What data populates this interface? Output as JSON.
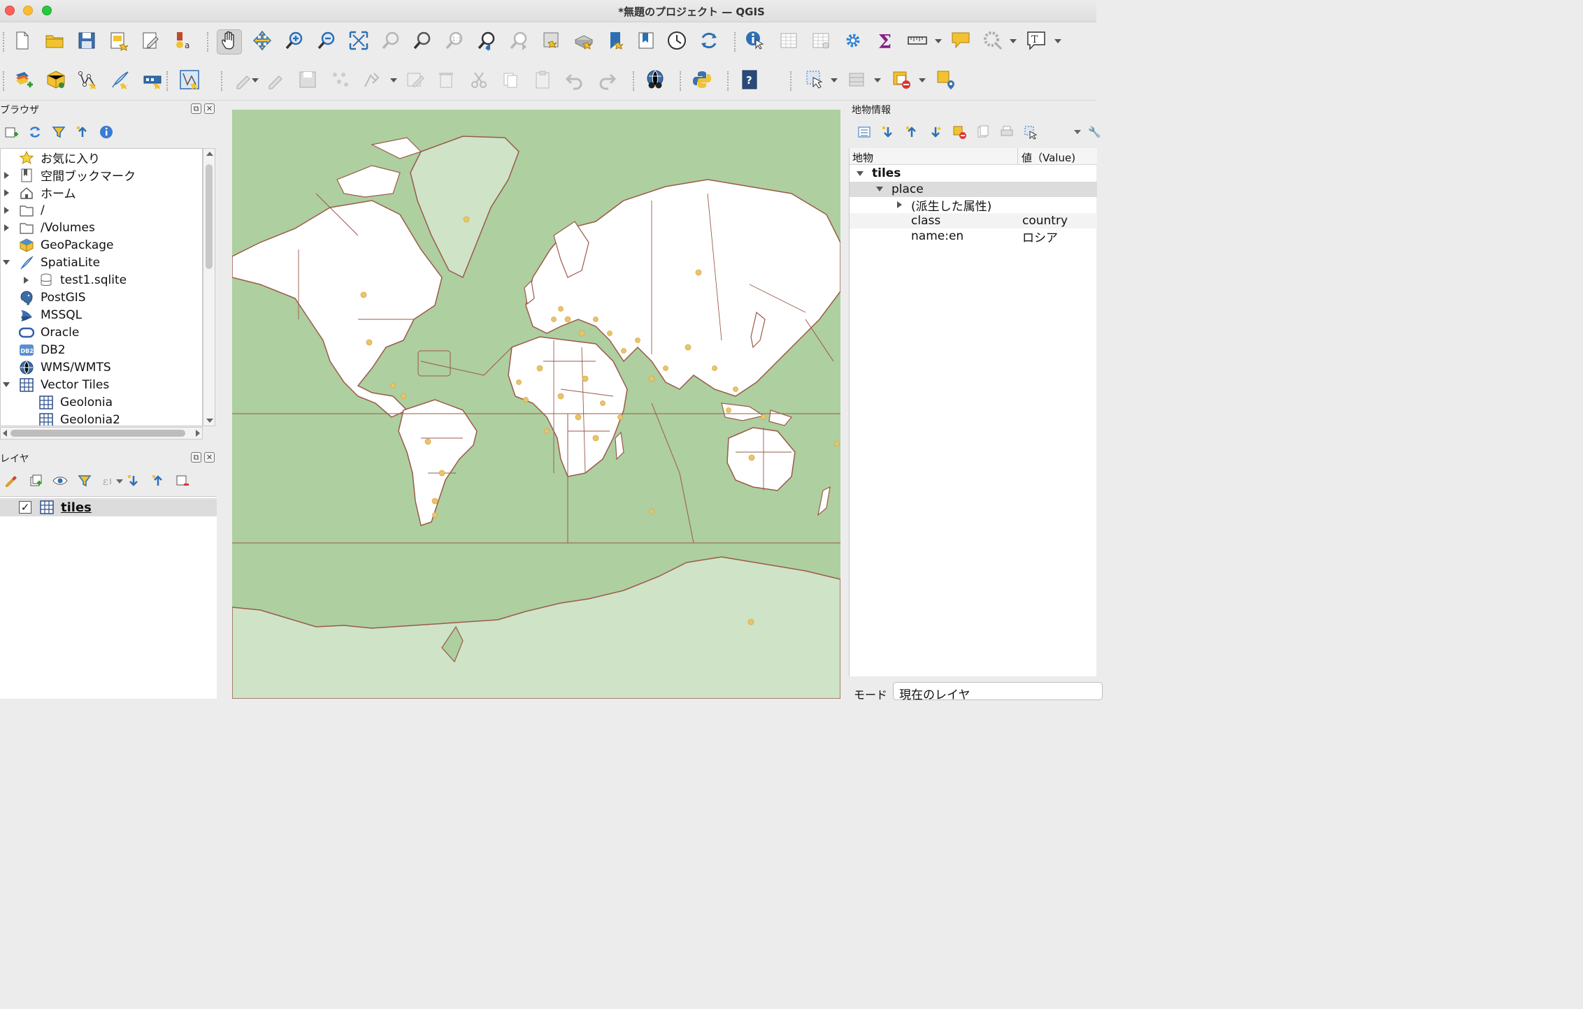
{
  "window": {
    "title": "*無題のプロジェクト — QGIS"
  },
  "toolbar1": [
    {
      "name": "new-project-icon"
    },
    {
      "name": "open-project-icon"
    },
    {
      "name": "save-project-icon"
    },
    {
      "name": "new-print-layout-icon"
    },
    {
      "name": "layout-manager-icon"
    },
    {
      "name": "style-manager-icon"
    },
    {
      "name": "pan-icon"
    },
    {
      "name": "pan-to-selection-icon"
    },
    {
      "name": "zoom-in-icon"
    },
    {
      "name": "zoom-out-icon"
    },
    {
      "name": "zoom-full-icon"
    },
    {
      "name": "zoom-to-selection-icon"
    },
    {
      "name": "zoom-to-layer-icon"
    },
    {
      "name": "zoom-native-icon"
    },
    {
      "name": "zoom-last-icon"
    },
    {
      "name": "zoom-next-icon"
    },
    {
      "name": "new-map-view-icon"
    },
    {
      "name": "new-3d-view-icon"
    },
    {
      "name": "new-bookmark-icon"
    },
    {
      "name": "show-bookmarks-icon"
    },
    {
      "name": "temporal-controller-icon"
    },
    {
      "name": "refresh-icon"
    },
    {
      "name": "identify-icon"
    },
    {
      "name": "attribute-table-icon"
    },
    {
      "name": "field-calculator-icon"
    },
    {
      "name": "processing-toolbox-icon"
    },
    {
      "name": "statistics-icon"
    },
    {
      "name": "measure-icon"
    },
    {
      "name": "map-tips-icon"
    },
    {
      "name": "annotation-icon"
    },
    {
      "name": "text-annotation-icon"
    }
  ],
  "toolbar2": [
    {
      "name": "data-source-manager-icon"
    },
    {
      "name": "new-geopackage-layer-icon"
    },
    {
      "name": "new-shapefile-layer-icon"
    },
    {
      "name": "new-spatialite-layer-icon"
    },
    {
      "name": "new-virtual-layer-icon"
    },
    {
      "name": "digitizing-icon"
    },
    {
      "name": "current-edits-icon"
    },
    {
      "name": "toggle-editing-icon"
    },
    {
      "name": "save-edits-icon"
    },
    {
      "name": "vertex-tool-icon"
    },
    {
      "name": "add-feature-icon"
    },
    {
      "name": "modify-attributes-icon"
    },
    {
      "name": "delete-selected-icon"
    },
    {
      "name": "cut-features-icon"
    },
    {
      "name": "copy-features-icon"
    },
    {
      "name": "paste-features-icon"
    },
    {
      "name": "undo-icon"
    },
    {
      "name": "redo-icon"
    },
    {
      "name": "quickosm-icon"
    },
    {
      "name": "python-console-icon"
    },
    {
      "name": "help-icon"
    },
    {
      "name": "select-features-icon"
    },
    {
      "name": "select-by-value-icon"
    },
    {
      "name": "deselect-all-icon"
    },
    {
      "name": "select-location-icon"
    }
  ],
  "browser": {
    "title": "ブラウザ",
    "items": [
      {
        "label": "お気に入り",
        "level": 0,
        "expander": "none",
        "icon": "star-icon"
      },
      {
        "label": "空間ブックマーク",
        "level": 0,
        "expander": "collapsed",
        "icon": "bookmark-icon"
      },
      {
        "label": "ホーム",
        "level": 0,
        "expander": "collapsed",
        "icon": "home-icon"
      },
      {
        "label": "/",
        "level": 0,
        "expander": "collapsed",
        "icon": "folder-icon"
      },
      {
        "label": "/Volumes",
        "level": 0,
        "expander": "collapsed",
        "icon": "folder-icon"
      },
      {
        "label": "GeoPackage",
        "level": 0,
        "expander": "none",
        "icon": "geopackage-icon"
      },
      {
        "label": "SpatiaLite",
        "level": 0,
        "expander": "expanded",
        "icon": "spatialite-icon"
      },
      {
        "label": "test1.sqlite",
        "level": 1,
        "expander": "collapsed",
        "icon": "database-icon"
      },
      {
        "label": "PostGIS",
        "level": 0,
        "expander": "none",
        "icon": "postgis-icon"
      },
      {
        "label": "MSSQL",
        "level": 0,
        "expander": "none",
        "icon": "mssql-icon"
      },
      {
        "label": "Oracle",
        "level": 0,
        "expander": "none",
        "icon": "oracle-icon"
      },
      {
        "label": "DB2",
        "level": 0,
        "expander": "none",
        "icon": "db2-icon"
      },
      {
        "label": "WMS/WMTS",
        "level": 0,
        "expander": "none",
        "icon": "globe-icon"
      },
      {
        "label": "Vector Tiles",
        "level": 0,
        "expander": "expanded",
        "icon": "vector-tiles-icon"
      },
      {
        "label": "Geolonia",
        "level": 1,
        "expander": "none",
        "icon": "vector-tiles-icon"
      },
      {
        "label": "Geolonia2",
        "level": 1,
        "expander": "none",
        "icon": "vector-tiles-icon"
      }
    ]
  },
  "layers": {
    "title": "レイヤ",
    "items": [
      {
        "label": "tiles",
        "checked": true,
        "check_mark": "✓"
      }
    ]
  },
  "identify": {
    "title": "地物情報",
    "col_feature": "地物",
    "col_value": "値（Value)",
    "rows": [
      {
        "label": "tiles",
        "value": "",
        "level": 0,
        "expander": "expanded",
        "bold": true
      },
      {
        "label": "place",
        "value": "",
        "level": 1,
        "expander": "expanded",
        "bold": false
      },
      {
        "label": "(派生した属性)",
        "value": "",
        "level": 2,
        "expander": "collapsed",
        "bold": false
      },
      {
        "label": "class",
        "value": "country",
        "level": 2,
        "expander": "none",
        "bold": false
      },
      {
        "label": "name:en",
        "value": "ロシア",
        "level": 2,
        "expander": "none",
        "bold": false
      }
    ],
    "mode_label": "モード",
    "mode_value": "現在のレイヤ"
  },
  "colors": {
    "map_ocean": "#aecf9f",
    "land": "#ffffff",
    "ice": "#cfe3c7",
    "border": "#9a5a4a",
    "place_dot": "#e9c46a"
  }
}
